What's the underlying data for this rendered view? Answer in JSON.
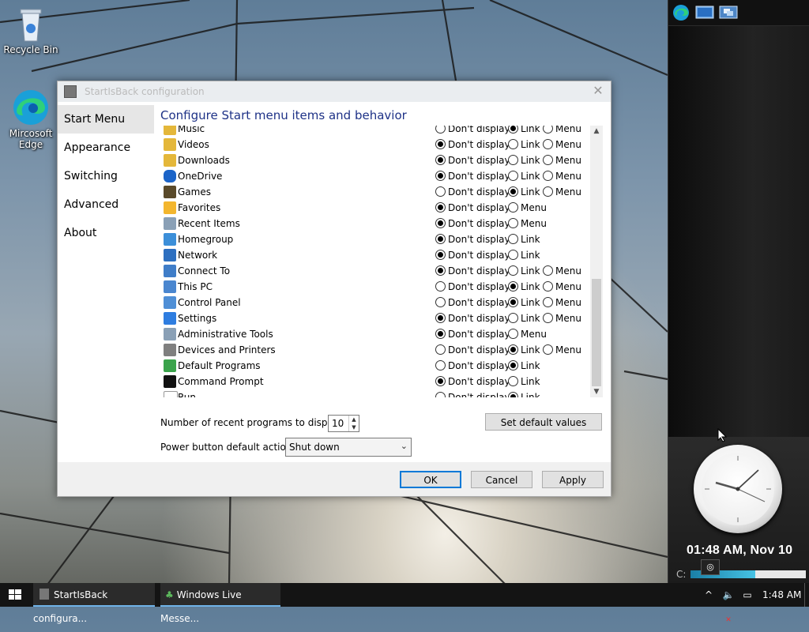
{
  "desktop": {
    "icons": [
      {
        "label": "Recycle Bin"
      },
      {
        "label": "Mircosoft Edge"
      }
    ]
  },
  "dialog": {
    "title": "StartIsBack configuration",
    "heading": "Configure Start menu items and behavior",
    "nav": [
      {
        "label": "Start Menu",
        "selected": true
      },
      {
        "label": "Appearance",
        "selected": false
      },
      {
        "label": "Switching",
        "selected": false
      },
      {
        "label": "Advanced",
        "selected": false
      },
      {
        "label": "About",
        "selected": false
      }
    ],
    "option_labels": {
      "dont": "Don't display",
      "link": "Link",
      "menu": "Menu"
    },
    "items": [
      {
        "name": "Music",
        "icon": "music-folder-icon",
        "choice": "link",
        "has_menu": true,
        "has_link": true
      },
      {
        "name": "Videos",
        "icon": "videos-folder-icon",
        "choice": "dont",
        "has_menu": true,
        "has_link": true
      },
      {
        "name": "Downloads",
        "icon": "downloads-folder-icon",
        "choice": "dont",
        "has_menu": true,
        "has_link": true
      },
      {
        "name": "OneDrive",
        "icon": "onedrive-cloud-icon",
        "choice": "dont",
        "has_menu": true,
        "has_link": true
      },
      {
        "name": "Games",
        "icon": "games-icon",
        "choice": "link",
        "has_menu": true,
        "has_link": true
      },
      {
        "name": "Favorites",
        "icon": "favorites-star-icon",
        "choice": "dont",
        "has_menu": true,
        "has_link": false
      },
      {
        "name": "Recent Items",
        "icon": "recent-items-icon",
        "choice": "dont",
        "has_menu": true,
        "has_link": false
      },
      {
        "name": "Homegroup",
        "icon": "homegroup-icon",
        "choice": "dont",
        "has_menu": false,
        "has_link": true
      },
      {
        "name": "Network",
        "icon": "network-icon",
        "choice": "dont",
        "has_menu": false,
        "has_link": true
      },
      {
        "name": "Connect To",
        "icon": "connect-to-icon",
        "choice": "dont",
        "has_menu": true,
        "has_link": true
      },
      {
        "name": "This PC",
        "icon": "this-pc-icon",
        "choice": "link",
        "has_menu": true,
        "has_link": true
      },
      {
        "name": "Control Panel",
        "icon": "control-panel-icon",
        "choice": "link",
        "has_menu": true,
        "has_link": true
      },
      {
        "name": "Settings",
        "icon": "settings-gear-icon",
        "choice": "dont",
        "has_menu": true,
        "has_link": true
      },
      {
        "name": "Administrative Tools",
        "icon": "admin-tools-icon",
        "choice": "dont",
        "has_menu": true,
        "has_link": false
      },
      {
        "name": "Devices and Printers",
        "icon": "printer-icon",
        "choice": "link",
        "has_menu": true,
        "has_link": true
      },
      {
        "name": "Default Programs",
        "icon": "default-programs-icon",
        "choice": "link",
        "has_menu": false,
        "has_link": true
      },
      {
        "name": "Command Prompt",
        "icon": "command-prompt-icon",
        "choice": "dont",
        "has_menu": false,
        "has_link": true
      },
      {
        "name": "Run",
        "icon": "run-icon",
        "choice": "link",
        "has_menu": false,
        "has_link": true
      }
    ],
    "recent_label": "Number of recent programs to display:",
    "recent_value": "10",
    "power_label": "Power button default action:",
    "power_value": "Shut down",
    "set_defaults": "Set default values",
    "ok": "OK",
    "cancel": "Cancel",
    "apply": "Apply"
  },
  "gadgets": {
    "clock_time": "01:48 AM, Nov 10",
    "drive_label": "C:",
    "drive_used_fraction": 0.56
  },
  "taskbar": {
    "apps": [
      {
        "label": "StartIsBack configura...",
        "active": true
      },
      {
        "label": "Windows Live Messe...",
        "active": true
      }
    ],
    "time": "1:48 AM"
  },
  "colors": {
    "heading": "#1e3287",
    "accent": "#0078d7"
  }
}
